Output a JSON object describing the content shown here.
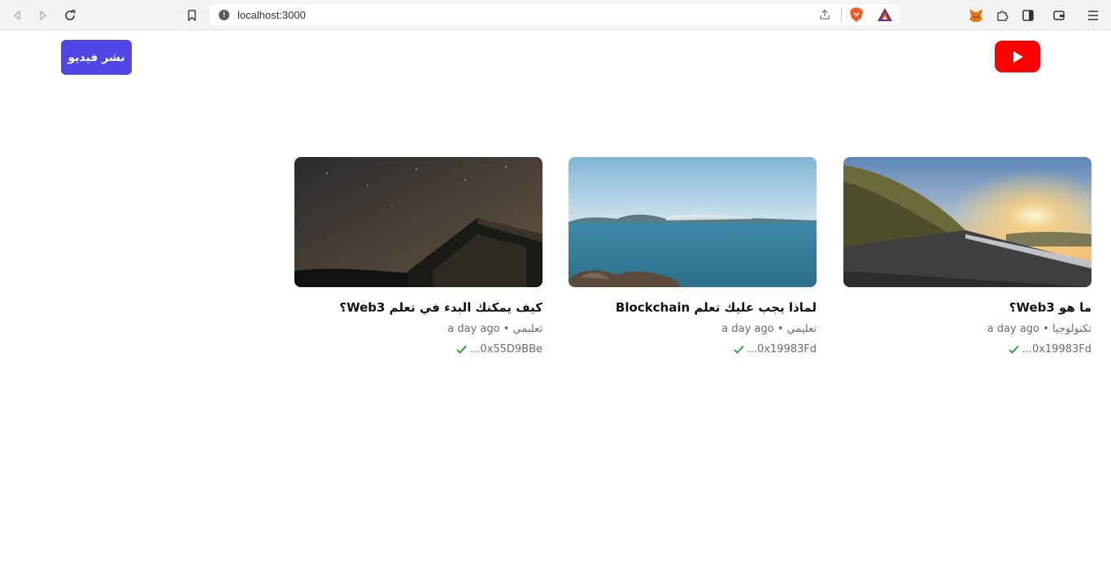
{
  "browser": {
    "url": "localhost:3000"
  },
  "header": {
    "publish_label": "نشر فيديو",
    "logo_icon": "youtube-play-icon"
  },
  "videos": [
    {
      "title": "ما هو Web3؟",
      "category": "تكنولوجيا",
      "time": "a day ago",
      "separator": "•",
      "owner": "0x19983Fd...",
      "thumbnail": "road-sunset-image"
    },
    {
      "title": "لماذا يجب عليك تعلم Blockchain",
      "category": "تعليمي",
      "time": "a day ago",
      "separator": "•",
      "owner": "0x19983Fd...",
      "thumbnail": "lake-mountains-image"
    },
    {
      "title": "كيف يمكنك البدء في تعلم Web3؟",
      "category": "تعليمي",
      "time": "a day ago",
      "separator": "•",
      "owner": "0x55D9BBe...",
      "thumbnail": "barn-night-sky-image"
    }
  ],
  "colors": {
    "accent": "#4f46e5",
    "youtube_red": "#ff0000",
    "verified_green": "#1a9a2a"
  }
}
